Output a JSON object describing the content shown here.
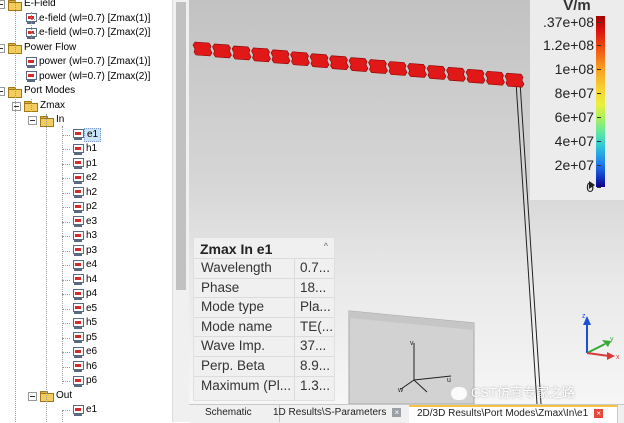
{
  "tree": {
    "items": [
      {
        "label": "E-Field",
        "type": "folder",
        "level": 1,
        "expanded": true
      },
      {
        "label": "e-field (wl=0.7) [Zmax(1)]",
        "type": "monitor",
        "level": 2
      },
      {
        "label": "e-field (wl=0.7) [Zmax(2)]",
        "type": "monitor",
        "level": 2
      },
      {
        "label": "Power Flow",
        "type": "folder",
        "level": 1,
        "expanded": true
      },
      {
        "label": "power (wl=0.7) [Zmax(1)]",
        "type": "monitor",
        "level": 2
      },
      {
        "label": "power (wl=0.7) [Zmax(2)]",
        "type": "monitor",
        "level": 2
      },
      {
        "label": "Port Modes",
        "type": "folder",
        "level": 1,
        "expanded": true
      },
      {
        "label": "Zmax",
        "type": "folder",
        "level": 2,
        "expanded": true
      },
      {
        "label": "In",
        "type": "folder",
        "level": 3,
        "expanded": true
      },
      {
        "label": "e1",
        "type": "monitor",
        "level": 4,
        "selected": true
      },
      {
        "label": "h1",
        "type": "monitor",
        "level": 4
      },
      {
        "label": "p1",
        "type": "monitor",
        "level": 4
      },
      {
        "label": "e2",
        "type": "monitor",
        "level": 4
      },
      {
        "label": "h2",
        "type": "monitor",
        "level": 4
      },
      {
        "label": "p2",
        "type": "monitor",
        "level": 4
      },
      {
        "label": "e3",
        "type": "monitor",
        "level": 4
      },
      {
        "label": "h3",
        "type": "monitor",
        "level": 4
      },
      {
        "label": "p3",
        "type": "monitor",
        "level": 4
      },
      {
        "label": "e4",
        "type": "monitor",
        "level": 4
      },
      {
        "label": "h4",
        "type": "monitor",
        "level": 4
      },
      {
        "label": "p4",
        "type": "monitor",
        "level": 4
      },
      {
        "label": "e5",
        "type": "monitor",
        "level": 4
      },
      {
        "label": "h5",
        "type": "monitor",
        "level": 4
      },
      {
        "label": "p5",
        "type": "monitor",
        "level": 4
      },
      {
        "label": "e6",
        "type": "monitor",
        "level": 4
      },
      {
        "label": "h6",
        "type": "monitor",
        "level": 4
      },
      {
        "label": "p6",
        "type": "monitor",
        "level": 4
      },
      {
        "label": "Out",
        "type": "folder",
        "level": 3,
        "expanded": true
      },
      {
        "label": "e1",
        "type": "monitor",
        "level": 4
      }
    ]
  },
  "legend": {
    "unit": "V/m",
    "ticks": [
      ".37e+08",
      "1.2e+08",
      "1e+08",
      "8e+07",
      "6e+07",
      "4e+07",
      "2e+07",
      "0"
    ]
  },
  "info": {
    "title": "Zmax In e1",
    "collapse_icon": "chevron-up-icon",
    "rows": [
      {
        "key": "Wavelength",
        "value": "0.7..."
      },
      {
        "key": "Phase",
        "value": "18..."
      },
      {
        "key": "Mode type",
        "value": "Pla..."
      },
      {
        "key": "Mode name",
        "value": "TE(..."
      },
      {
        "key": "Wave Imp.",
        "value": "37..."
      },
      {
        "key": "Perp. Beta",
        "value": "8.9..."
      },
      {
        "key": "Maximum (Pl...",
        "value": "1.3..."
      }
    ]
  },
  "watermark": "CST仿真专家之路",
  "tabs": [
    {
      "label": "Schematic",
      "closable": false,
      "active": false
    },
    {
      "label": "1D Results\\S-Parameters",
      "closable": true,
      "active": false
    },
    {
      "label": "2D/3D Results\\Port Modes\\Zmax\\In\\e1",
      "closable": true,
      "active": true
    }
  ],
  "colors": {
    "selection": "#cce4f7",
    "field_red": "#e01818",
    "tab_active_accent": "#f5c342",
    "close_active": "#e34a3a"
  }
}
